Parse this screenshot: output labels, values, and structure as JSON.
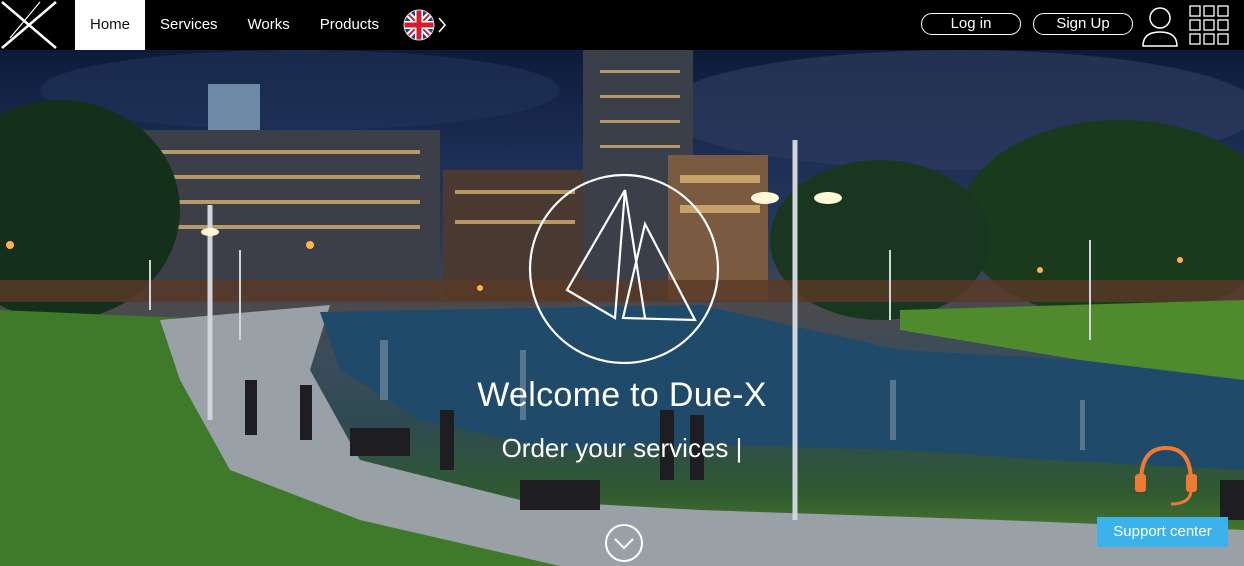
{
  "header": {
    "nav": [
      {
        "label": "Home",
        "active": true
      },
      {
        "label": "Services",
        "active": false
      },
      {
        "label": "Works",
        "active": false
      },
      {
        "label": "Products",
        "active": false
      }
    ],
    "language_icon": "uk-flag-icon",
    "login_label": "Log in",
    "signup_label": "Sign Up"
  },
  "hero": {
    "welcome": "Welcome to Due-X",
    "tagline": "Order your services |"
  },
  "support": {
    "label": "Support center",
    "icon": "headset-icon"
  },
  "colors": {
    "header_bg": "#000000",
    "support_bg": "#3bb3ea",
    "headset": "#f07a33"
  }
}
